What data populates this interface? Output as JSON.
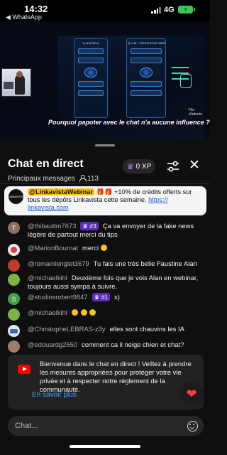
{
  "status_bar": {
    "time": "14:32",
    "back_label": "◀ WhatsApp",
    "network": "4G",
    "battery_icon": "charging-bolt"
  },
  "video": {
    "panel_left_title": "1) LLM SEUL",
    "panel_right_title": "2) LLM + RECHERCHE WEB",
    "queue_label": "File d'attente",
    "caption": "Pourquoi papoter avec le chat n'a aucune influence ?"
  },
  "chat": {
    "title": "Chat en direct",
    "subtitle": "Principaux messages",
    "viewer_count": "113",
    "xp": "0 XP"
  },
  "pinned": {
    "tag": "@LinkavistaWebinar",
    "text": "+10% de crédits offerts sur tous les dépôts Linkavista cette semaine.",
    "link": "https:// linkavista.com",
    "logo_text": "LINKAVISTA"
  },
  "messages": [
    {
      "author": "@thibaultm7673",
      "badge": "#3",
      "text": "Ça va envoyer de la fake news légère de partout merci du tips",
      "avatar_letter": "T",
      "avatar_color": "#8d6e63"
    },
    {
      "author": "@MarionBournat",
      "badge": "",
      "text": "merci",
      "avatar_letter": "",
      "avatar_color": "#e8e8e8"
    },
    {
      "author": "@romainlenglet3679",
      "badge": "",
      "text": "Tu fais une très belle Faustine Alan",
      "avatar_letter": "",
      "avatar_color": "#c0392b"
    },
    {
      "author": "@michaelkihl",
      "badge": "",
      "text": "Deuxième fois que je vois Alan en webinar, toujours aussi sympa à suivre.",
      "avatar_letter": "",
      "avatar_color": "#7cb342"
    },
    {
      "author": "@studiosrobert9847",
      "badge": "#1",
      "text": "x)",
      "avatar_letter": "S",
      "avatar_color": "#43a047"
    },
    {
      "author": "@michaelkihl",
      "badge": "",
      "text": "",
      "avatar_letter": "",
      "avatar_color": "#7cb342"
    },
    {
      "author": "@ChristopheLEBRAS-z3y",
      "badge": "",
      "text": "elles sont chauvins les IA",
      "avatar_letter": "",
      "avatar_color": "#dfe8f0"
    },
    {
      "author": "@edouardg2550",
      "badge": "",
      "text": "comment ca il neige chien et chat?",
      "avatar_letter": "",
      "avatar_color": "#9e7b6a"
    }
  ],
  "notice": {
    "text": "Bienvenue dans le chat en direct ! Veillez à prendre les mesures appropriées pour protéger votre vie privée et à respecter notre règlement de la communauté.",
    "link": "En savoir plus"
  },
  "input": {
    "placeholder": "Chat..."
  },
  "colors": {
    "accent_blue": "#3ea6ff",
    "badge_purple": "#5c2eb8",
    "youtube_red": "#ff0000",
    "pinned_tag_yellow": "#ffc107"
  }
}
